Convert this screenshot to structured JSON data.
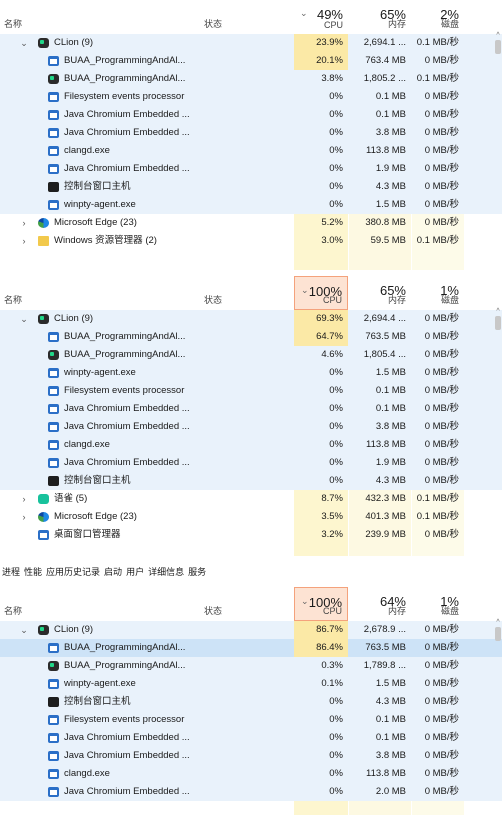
{
  "tabs": [
    "进程",
    "性能",
    "应用历史记录",
    "启动",
    "用户",
    "详细信息",
    "服务"
  ],
  "headers": {
    "name": "名称",
    "status": "状态",
    "cpu": "CPU",
    "mem": "内存",
    "disk": "磁盘",
    "sort": "⌄"
  },
  "colors": {
    "cpu_hot": "#fde3d3",
    "cpu_col": "#fdf6cf",
    "mem_col": "#fdf9e2",
    "disk_col": "#fdfbe9",
    "cpu_mid": "#fbe9a6",
    "selected": "#cde3f7"
  },
  "panels": [
    {
      "summary": {
        "cpu": "49%",
        "mem": "65%",
        "disk": "2%"
      },
      "cpu_sorted": false,
      "rows": [
        {
          "name": "CLion (9)",
          "icon": "clion-icon",
          "level": 0,
          "chev": "⌄",
          "cpu": "23.9%",
          "mem": "2,694.1 ...",
          "disk": "0.1 MB/秒",
          "shade": "mid"
        },
        {
          "name": "BUAA_ProgrammingAndAl...",
          "icon": "window-icon",
          "level": 1,
          "cpu": "20.1%",
          "mem": "763.4 MB",
          "disk": "0 MB/秒",
          "shade": "mid"
        },
        {
          "name": "BUAA_ProgrammingAndAl...",
          "icon": "clion-icon",
          "level": 1,
          "cpu": "3.8%",
          "mem": "1,805.2 ...",
          "disk": "0.1 MB/秒"
        },
        {
          "name": "Filesystem events processor",
          "icon": "window-icon",
          "level": 1,
          "cpu": "0%",
          "mem": "0.1 MB",
          "disk": "0 MB/秒"
        },
        {
          "name": "Java Chromium Embedded ...",
          "icon": "window-icon",
          "level": 1,
          "cpu": "0%",
          "mem": "0.1 MB",
          "disk": "0 MB/秒"
        },
        {
          "name": "Java Chromium Embedded ...",
          "icon": "window-icon",
          "level": 1,
          "cpu": "0%",
          "mem": "3.8 MB",
          "disk": "0 MB/秒"
        },
        {
          "name": "clangd.exe",
          "icon": "window-icon",
          "level": 1,
          "cpu": "0%",
          "mem": "113.8 MB",
          "disk": "0 MB/秒"
        },
        {
          "name": "Java Chromium Embedded ...",
          "icon": "window-icon",
          "level": 1,
          "cpu": "0%",
          "mem": "1.9 MB",
          "disk": "0 MB/秒"
        },
        {
          "name": "控制台窗口主机",
          "icon": "console-icon",
          "level": 1,
          "cpu": "0%",
          "mem": "4.3 MB",
          "disk": "0 MB/秒"
        },
        {
          "name": "winpty-agent.exe",
          "icon": "window-icon",
          "level": 1,
          "cpu": "0%",
          "mem": "1.5 MB",
          "disk": "0 MB/秒"
        },
        {
          "name": "Microsoft Edge (23)",
          "icon": "edge-icon",
          "level": 0,
          "chev": "›",
          "cpu": "5.2%",
          "mem": "380.8 MB",
          "disk": "0 MB/秒"
        },
        {
          "name": "Windows 资源管理器 (2)",
          "icon": "folder-icon",
          "level": 0,
          "chev": "›",
          "cpu": "3.0%",
          "mem": "59.5 MB",
          "disk": "0.1 MB/秒"
        }
      ]
    },
    {
      "summary": {
        "cpu": "100%",
        "mem": "65%",
        "disk": "1%"
      },
      "cpu_sorted": true,
      "rows": [
        {
          "name": "CLion (9)",
          "icon": "clion-icon",
          "level": 0,
          "chev": "⌄",
          "cpu": "69.3%",
          "mem": "2,694.4 ...",
          "disk": "0 MB/秒",
          "shade": "mid"
        },
        {
          "name": "BUAA_ProgrammingAndAl...",
          "icon": "window-icon",
          "level": 1,
          "cpu": "64.7%",
          "mem": "763.5 MB",
          "disk": "0 MB/秒",
          "shade": "mid"
        },
        {
          "name": "BUAA_ProgrammingAndAl...",
          "icon": "clion-icon",
          "level": 1,
          "cpu": "4.6%",
          "mem": "1,805.4 ...",
          "disk": "0 MB/秒"
        },
        {
          "name": "winpty-agent.exe",
          "icon": "window-icon",
          "level": 1,
          "cpu": "0%",
          "mem": "1.5 MB",
          "disk": "0 MB/秒"
        },
        {
          "name": "Filesystem events processor",
          "icon": "window-icon",
          "level": 1,
          "cpu": "0%",
          "mem": "0.1 MB",
          "disk": "0 MB/秒"
        },
        {
          "name": "Java Chromium Embedded ...",
          "icon": "window-icon",
          "level": 1,
          "cpu": "0%",
          "mem": "0.1 MB",
          "disk": "0 MB/秒"
        },
        {
          "name": "Java Chromium Embedded ...",
          "icon": "window-icon",
          "level": 1,
          "cpu": "0%",
          "mem": "3.8 MB",
          "disk": "0 MB/秒"
        },
        {
          "name": "clangd.exe",
          "icon": "window-icon",
          "level": 1,
          "cpu": "0%",
          "mem": "113.8 MB",
          "disk": "0 MB/秒"
        },
        {
          "name": "Java Chromium Embedded ...",
          "icon": "window-icon",
          "level": 1,
          "cpu": "0%",
          "mem": "1.9 MB",
          "disk": "0 MB/秒"
        },
        {
          "name": "控制台窗口主机",
          "icon": "console-icon",
          "level": 1,
          "cpu": "0%",
          "mem": "4.3 MB",
          "disk": "0 MB/秒"
        },
        {
          "name": "语雀 (5)",
          "icon": "yuque-icon",
          "level": 0,
          "chev": "›",
          "cpu": "8.7%",
          "mem": "432.3 MB",
          "disk": "0.1 MB/秒"
        },
        {
          "name": "Microsoft Edge (23)",
          "icon": "edge-icon",
          "level": 0,
          "chev": "›",
          "cpu": "3.5%",
          "mem": "401.3 MB",
          "disk": "0.1 MB/秒"
        },
        {
          "name": "桌面窗口管理器",
          "icon": "window-icon",
          "level": 0,
          "cpu": "3.2%",
          "mem": "239.9 MB",
          "disk": "0 MB/秒"
        }
      ]
    },
    {
      "summary": {
        "cpu": "100%",
        "mem": "64%",
        "disk": "1%"
      },
      "cpu_sorted": true,
      "rows": [
        {
          "name": "CLion (9)",
          "icon": "clion-icon",
          "level": 0,
          "chev": "⌄",
          "cpu": "86.7%",
          "mem": "2,678.9 ...",
          "disk": "0 MB/秒",
          "shade": "mid"
        },
        {
          "name": "BUAA_ProgrammingAndAl...",
          "icon": "window-icon",
          "level": 1,
          "cpu": "86.4%",
          "mem": "763.5 MB",
          "disk": "0 MB/秒",
          "shade": "mid",
          "selected": true
        },
        {
          "name": "BUAA_ProgrammingAndAl...",
          "icon": "clion-icon",
          "level": 1,
          "cpu": "0.3%",
          "mem": "1,789.8 ...",
          "disk": "0 MB/秒"
        },
        {
          "name": "winpty-agent.exe",
          "icon": "window-icon",
          "level": 1,
          "cpu": "0.1%",
          "mem": "1.5 MB",
          "disk": "0 MB/秒"
        },
        {
          "name": "控制台窗口主机",
          "icon": "console-icon",
          "level": 1,
          "cpu": "0%",
          "mem": "4.3 MB",
          "disk": "0 MB/秒"
        },
        {
          "name": "Filesystem events processor",
          "icon": "window-icon",
          "level": 1,
          "cpu": "0%",
          "mem": "0.1 MB",
          "disk": "0 MB/秒"
        },
        {
          "name": "Java Chromium Embedded ...",
          "icon": "window-icon",
          "level": 1,
          "cpu": "0%",
          "mem": "0.1 MB",
          "disk": "0 MB/秒"
        },
        {
          "name": "Java Chromium Embedded ...",
          "icon": "window-icon",
          "level": 1,
          "cpu": "0%",
          "mem": "3.8 MB",
          "disk": "0 MB/秒"
        },
        {
          "name": "clangd.exe",
          "icon": "window-icon",
          "level": 1,
          "cpu": "0%",
          "mem": "113.8 MB",
          "disk": "0 MB/秒"
        },
        {
          "name": "Java Chromium Embedded ...",
          "icon": "window-icon",
          "level": 1,
          "cpu": "0%",
          "mem": "2.0 MB",
          "disk": "0 MB/秒"
        }
      ]
    }
  ]
}
